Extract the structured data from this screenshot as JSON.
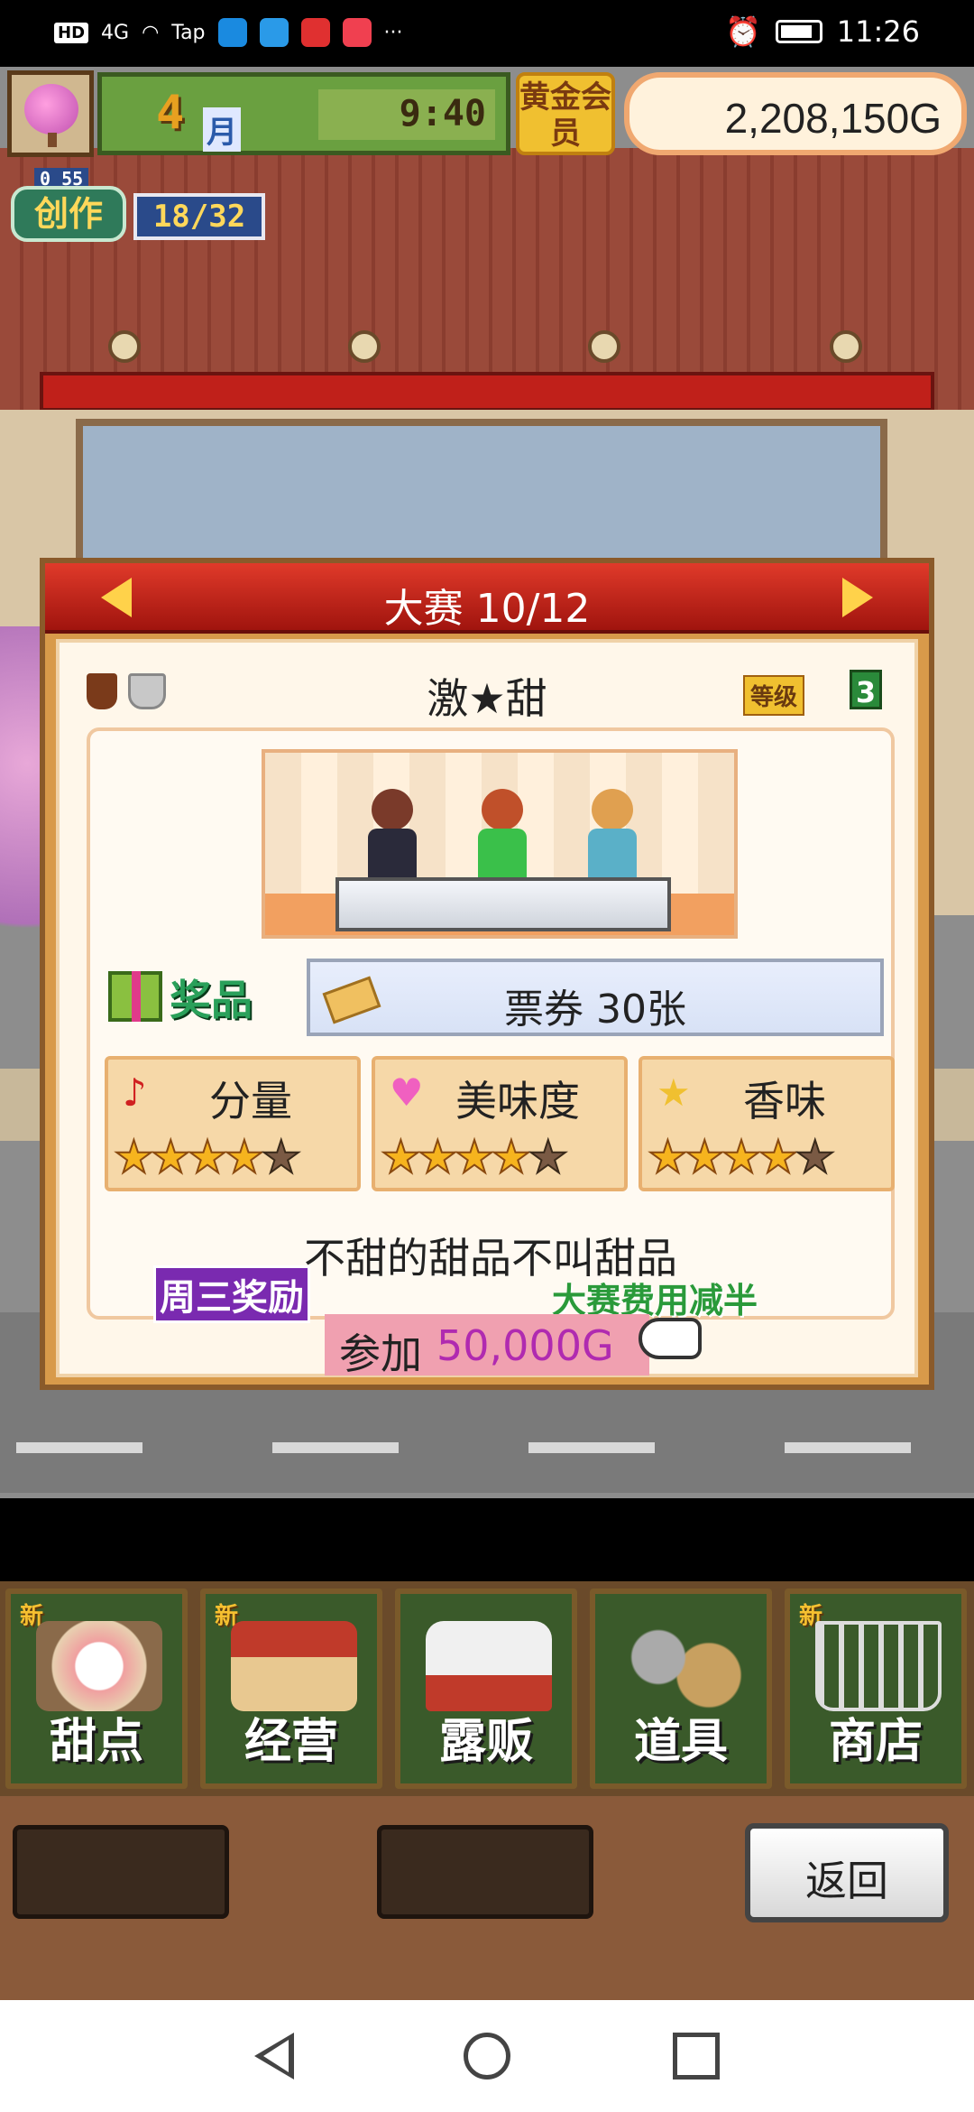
{
  "status_bar": {
    "network_badge": "HD",
    "signal": "4G",
    "apps": [
      "Tap"
    ],
    "more": "···",
    "time": "11:26"
  },
  "hud": {
    "month": "4",
    "month_label": "月",
    "time": "9:40",
    "gold_member": "黄金会员",
    "money": "2,208,150G",
    "create_label": "创作",
    "create_small": "0 55",
    "create_progress": "18/32"
  },
  "contest": {
    "header": "大赛 10/12",
    "name": "激★甜",
    "grade_label": "等级",
    "grade_value": "3",
    "prize_label": "奖品",
    "prize": "票券 30张",
    "ratings": [
      {
        "label": "分量",
        "icon": "music-note-icon",
        "icon_glyph": "♪",
        "icon_color": "#d02020",
        "stars": 4,
        "max": 5
      },
      {
        "label": "美味度",
        "icon": "heart-icon",
        "icon_glyph": "♥",
        "icon_color": "#f060c0",
        "stars": 4,
        "max": 5
      },
      {
        "label": "香味",
        "icon": "star-icon",
        "icon_glyph": "★",
        "icon_color": "#f0c030",
        "stars": 4,
        "max": 5
      }
    ],
    "tagline": "不甜的甜品不叫甜品",
    "weekly_bonus": "周三奖励",
    "discount_note": "大赛费用减半",
    "join_label": "参加",
    "join_fee": "50,000G"
  },
  "menu": [
    {
      "label": "甜点",
      "new": true,
      "icon": "cake-icon"
    },
    {
      "label": "经营",
      "new": true,
      "icon": "shop-icon"
    },
    {
      "label": "露贩",
      "new": false,
      "icon": "food-truck-icon"
    },
    {
      "label": "道具",
      "new": false,
      "icon": "item-bag-icon"
    },
    {
      "label": "商店",
      "new": true,
      "icon": "shopping-cart-icon"
    }
  ],
  "new_badge": "新",
  "back_button": "返回",
  "colors": {
    "header_red": "#c02018",
    "accent_gold": "#f6b41e",
    "menu_green": "#3a5a2a"
  }
}
